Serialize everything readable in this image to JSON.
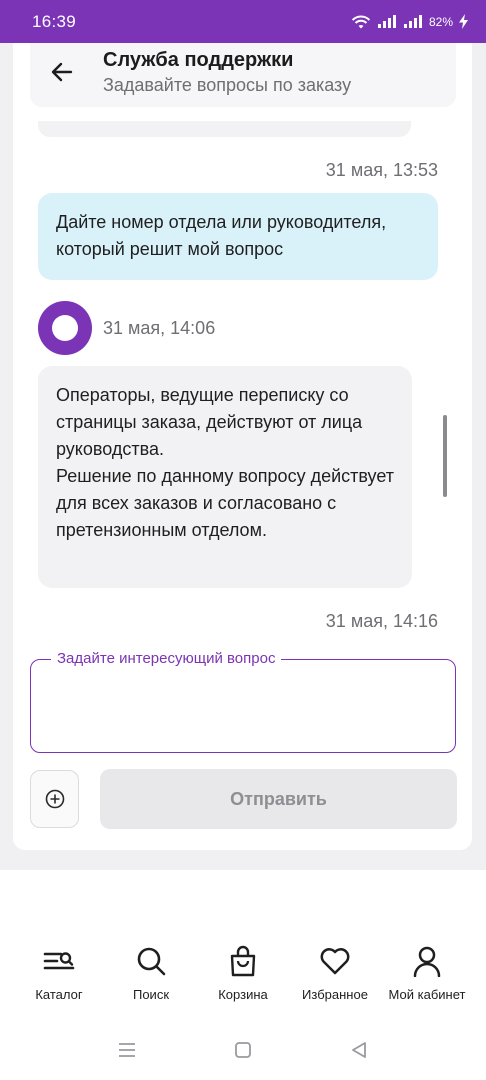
{
  "status_bar": {
    "time": "16:39",
    "battery": "82%"
  },
  "header": {
    "title": "Служба поддержки",
    "subtitle": "Задавайте вопросы по заказу"
  },
  "messages": [
    {
      "timestamp": "31 мая, 13:53",
      "direction": "outgoing",
      "text": "Дайте номер отдела или руководителя, который решит мой вопрос"
    },
    {
      "timestamp": "31 мая, 14:06",
      "direction": "incoming",
      "paragraphs": [
        "Операторы, ведущие переписку со страницы заказа, действуют от лица руководства.",
        "Решение по данному вопросу действует для всех заказов и согласовано с претензионным отделом."
      ]
    },
    {
      "timestamp": "31 мая, 14:16",
      "direction": "outgoing"
    }
  ],
  "input": {
    "label": "Задайте интересующий вопрос",
    "value": ""
  },
  "send_button": "Отправить",
  "bottom_nav": [
    {
      "label": "Каталог",
      "icon": "catalog-icon"
    },
    {
      "label": "Поиск",
      "icon": "search-icon"
    },
    {
      "label": "Корзина",
      "icon": "bag-icon"
    },
    {
      "label": "Избранное",
      "icon": "heart-icon"
    },
    {
      "label": "Мой кабинет",
      "icon": "profile-icon"
    }
  ],
  "colors": {
    "brand": "#7b34b5",
    "outgoing_bubble": "#d9f2fa",
    "incoming_bubble": "#f2f2f4"
  }
}
